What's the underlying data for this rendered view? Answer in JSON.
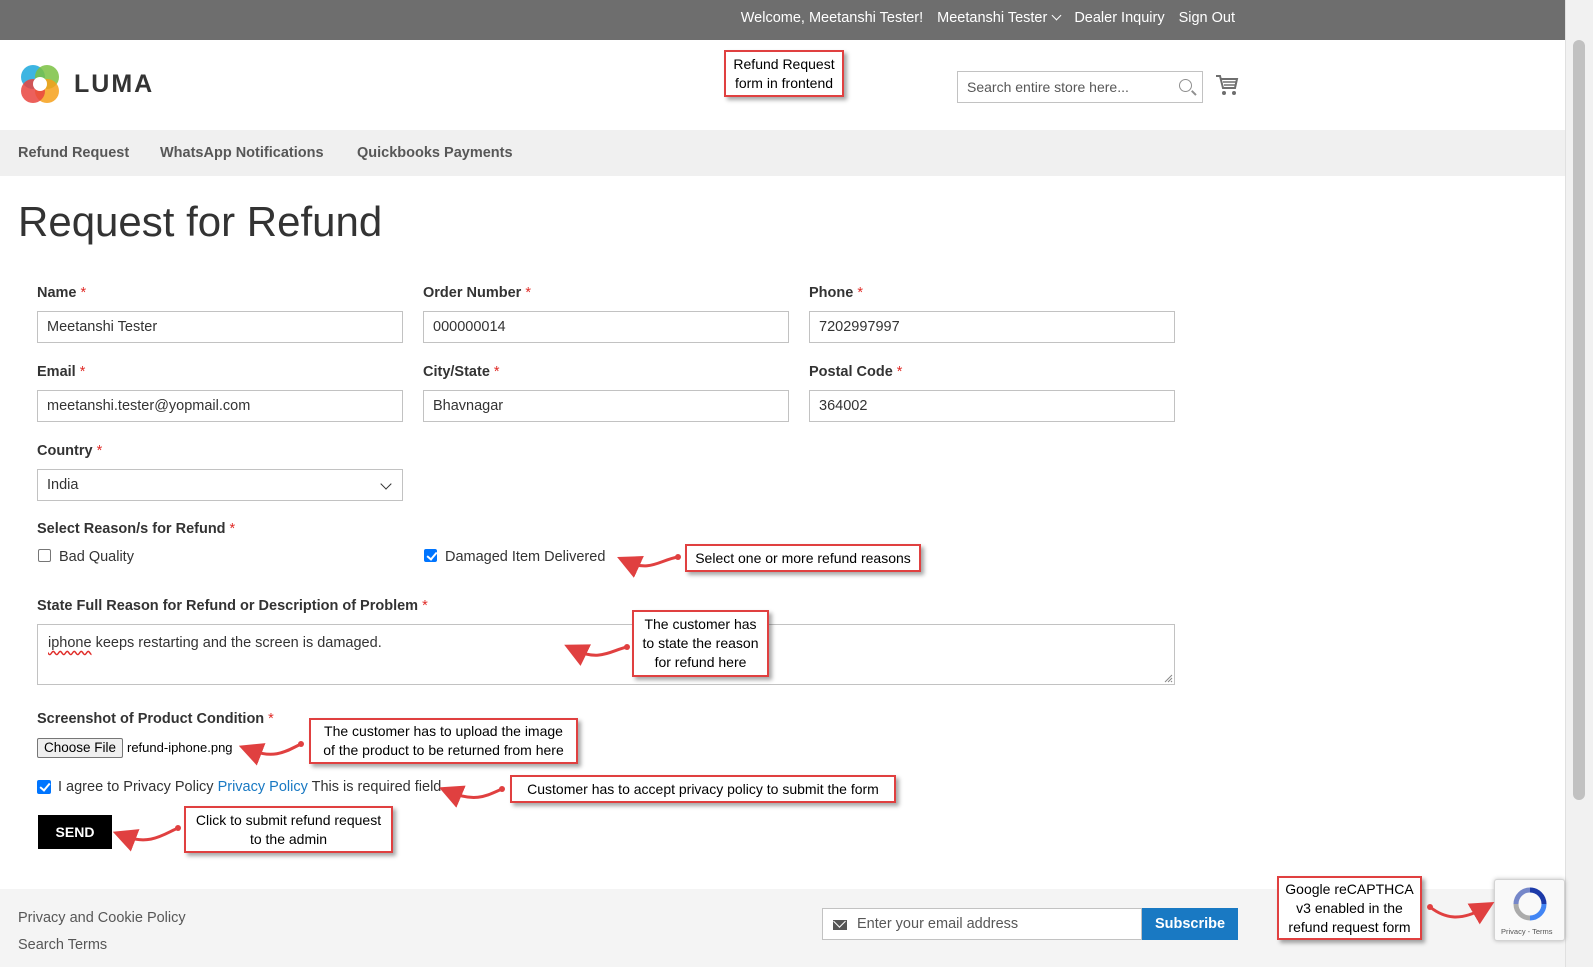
{
  "topbar": {
    "welcome": "Welcome, Meetanshi Tester!",
    "account": "Meetanshi Tester",
    "dealer": "Dealer Inquiry",
    "signout": "Sign Out"
  },
  "header": {
    "logo_text": "LUMA",
    "search_placeholder": "Search entire store here..."
  },
  "nav": [
    "Refund Request",
    "WhatsApp Notifications",
    "Quickbooks Payments"
  ],
  "page": {
    "title": "Request for Refund"
  },
  "form": {
    "name": {
      "label": "Name",
      "value": "Meetanshi Tester"
    },
    "order": {
      "label": "Order Number",
      "value": "000000014"
    },
    "phone": {
      "label": "Phone",
      "value": "7202997997"
    },
    "email": {
      "label": "Email",
      "value": "meetanshi.tester@yopmail.com"
    },
    "city": {
      "label": "City/State",
      "value": "Bhavnagar"
    },
    "postal": {
      "label": "Postal Code",
      "value": "364002"
    },
    "country": {
      "label": "Country",
      "value": "India"
    },
    "reasons": {
      "label": "Select Reason/s for Refund",
      "options": [
        {
          "label": "Bad Quality",
          "checked": false
        },
        {
          "label": "Damaged Item Delivered",
          "checked": true
        }
      ]
    },
    "description": {
      "label": "State Full Reason for Refund or Description of Problem",
      "value_misspelled": "iphone",
      "value_rest": " keeps restarting and the screen is damaged."
    },
    "screenshot": {
      "label": "Screenshot of Product Condition",
      "button": "Choose File",
      "filename": "refund-iphone.png"
    },
    "agree": {
      "checked": true,
      "text": "I agree to Privacy Policy",
      "link": "Privacy Policy",
      "note": "This is required field."
    },
    "submit": "SEND",
    "required_mark": "*"
  },
  "footer": {
    "links": [
      "Privacy and Cookie Policy",
      "Search Terms"
    ],
    "newsletter_placeholder": "Enter your email address",
    "subscribe": "Subscribe"
  },
  "recaptcha": {
    "text": "Privacy - Terms"
  },
  "annotations": {
    "frontend": [
      "Refund Request",
      "form in frontend"
    ],
    "reasons": [
      "Select one or more refund reasons"
    ],
    "describe": [
      "The customer has",
      "to state the reason",
      "for refund here"
    ],
    "upload": [
      "The customer has to upload the image",
      "of the product to be returned from here"
    ],
    "privacy": [
      "Customer has to accept privacy policy to submit the form"
    ],
    "submit": [
      "Click to submit refund request",
      "to the admin"
    ],
    "recaptcha": [
      "Google reCAPTHCA",
      "v3 enabled in the",
      "refund request form"
    ]
  },
  "colors": {
    "topbar": "#6e6e6e",
    "link": "#1979c3",
    "required": "#e02b27",
    "annotation_border": "#e04040"
  }
}
